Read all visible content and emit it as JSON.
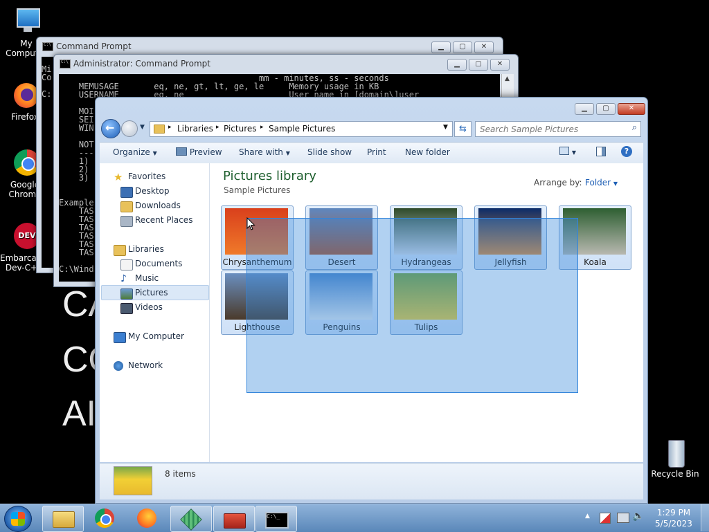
{
  "desktop": {
    "icons": [
      {
        "label": "My Computer",
        "icon": "computer-icon"
      },
      {
        "label": "Firefox",
        "icon": "firefox-icon"
      },
      {
        "label": "Google Chrome",
        "icon": "chrome-icon"
      },
      {
        "label": "Embarcadero Dev-C++",
        "icon": "devcpp-icon"
      }
    ],
    "recycle_bin": "Recycle Bin",
    "background_text": [
      "CA",
      "CO",
      "AI"
    ]
  },
  "cmd_back": {
    "title": "Command Prompt",
    "lines": [
      "Mi",
      "Co",
      "",
      "C:"
    ]
  },
  "cmd_front": {
    "title": "Administrator: Command Prompt",
    "lines": [
      "                                        mm - minutes, ss - seconds",
      "    MEMUSAGE       eq, ne, gt, lt, ge, le     Memory usage in KB",
      "    USERNAME       eq, ne                     User name in [domain\\]user",
      "",
      "    MOI",
      "    SEI",
      "    WIN",
      "",
      "    NOT",
      "    ---",
      "    1)",
      "    2)",
      "    3)",
      "",
      "",
      "Example",
      "    TAS",
      "    TAS",
      "    TAS",
      "    TAS",
      "    TAS",
      "    TAS",
      "",
      "C:\\Wind"
    ]
  },
  "explorer": {
    "breadcrumb": [
      "Libraries",
      "Pictures",
      "Sample Pictures"
    ],
    "search_placeholder": "Search Sample Pictures",
    "toolbar": {
      "organize": "Organize",
      "preview": "Preview",
      "share_with": "Share with",
      "slide_show": "Slide show",
      "print": "Print",
      "new_folder": "New folder"
    },
    "nav": {
      "favorites": "Favorites",
      "desktop": "Desktop",
      "downloads": "Downloads",
      "recent_places": "Recent Places",
      "libraries": "Libraries",
      "documents": "Documents",
      "music": "Music",
      "pictures": "Pictures",
      "videos": "Videos",
      "my_computer": "My Computer",
      "network": "Network"
    },
    "library_title": "Pictures library",
    "library_subtitle": "Sample Pictures",
    "arrange_label": "Arrange by:",
    "arrange_value": "Folder",
    "items": [
      {
        "name": "Chrysanthemum",
        "colors": [
          "#d9401c",
          "#f07a2a"
        ]
      },
      {
        "name": "Desert",
        "colors": [
          "#5e88c0",
          "#b0542a"
        ]
      },
      {
        "name": "Hydrangeas",
        "colors": [
          "#2e4a2a",
          "#d8dde8"
        ]
      },
      {
        "name": "Jellyfish",
        "colors": [
          "#0b2c6a",
          "#e08a36"
        ]
      },
      {
        "name": "Koala",
        "colors": [
          "#2e5f32",
          "#b8b8b0"
        ]
      },
      {
        "name": "Lighthouse",
        "colors": [
          "#6a8fc0",
          "#4a3a2a"
        ]
      },
      {
        "name": "Penguins",
        "colors": [
          "#4f86c8",
          "#e8ecef"
        ]
      },
      {
        "name": "Tulips",
        "colors": [
          "#79a63b",
          "#f2d035"
        ]
      }
    ],
    "status_count": "8 items"
  },
  "taskbar": {
    "time": "1:29 PM",
    "date": "5/5/2023"
  }
}
